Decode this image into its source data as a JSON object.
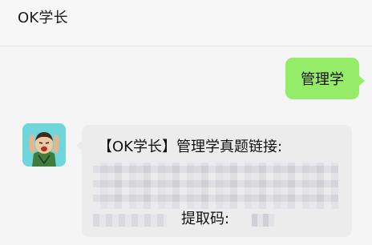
{
  "header": {
    "title": "OK学长"
  },
  "messages": {
    "outgoing": {
      "text": "管理学"
    },
    "incoming": {
      "line1": "【OK学长】管理学真题链接:",
      "code_label": "提取码:"
    }
  },
  "colors": {
    "outgoing_bubble": "#95ec69",
    "incoming_bubble": "#ececec",
    "background": "#f5f5f5",
    "avatar_bg": "#6fd6dc"
  }
}
